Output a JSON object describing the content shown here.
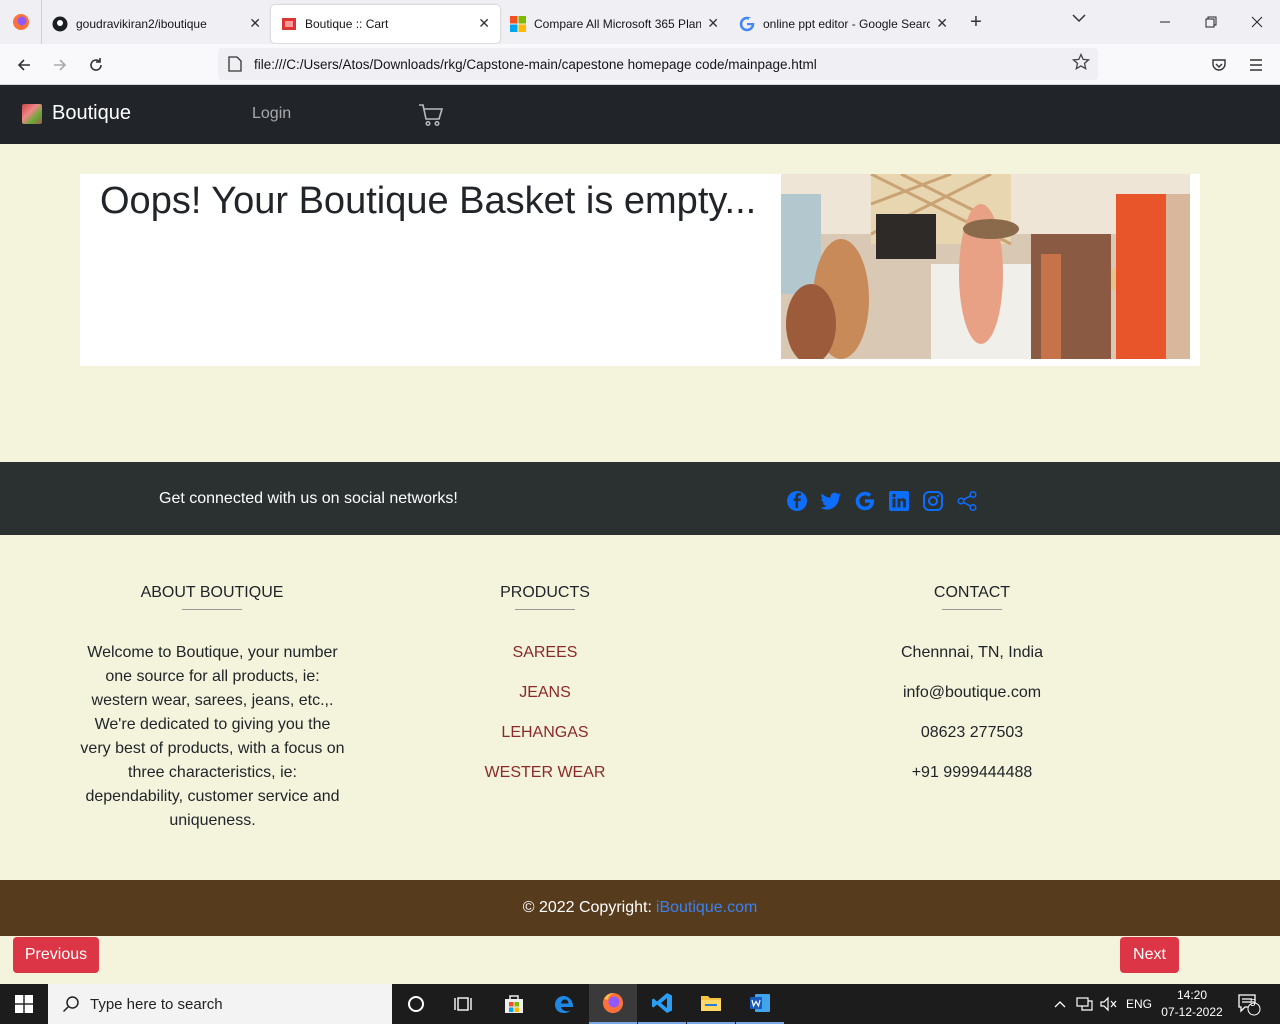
{
  "browser": {
    "tabs": [
      {
        "title": "goudravikiran2/iboutique",
        "icon": "github-icon",
        "active": false
      },
      {
        "title": "Boutique :: Cart",
        "icon": "boutique-favicon",
        "active": true
      },
      {
        "title": "Compare All Microsoft 365 Plan",
        "icon": "microsoft-icon",
        "active": false
      },
      {
        "title": "online ppt editor - Google Searc",
        "icon": "google-icon",
        "active": false
      }
    ],
    "close_glyph": "✕",
    "new_tab_glyph": "+",
    "url": "file:///C:/Users/Atos/Downloads/rkg/Capstone-main/capestone homepage code/mainpage.html"
  },
  "site": {
    "brand": "Boutique",
    "login": "Login",
    "empty_message": "Oops! Your Boutique Basket is empty...",
    "social_text": "Get connected with us on social networks!",
    "social_icons": [
      "facebook-icon",
      "twitter-icon",
      "google-icon",
      "linkedin-icon",
      "instagram-icon",
      "share-icon"
    ],
    "about": {
      "heading": "ABOUT BOUTIQUE",
      "text": "Welcome to Boutique, your number one source for all products, ie: western wear, sarees, jeans, etc.,. We're dedicated to giving you the very best of products, with a focus on three characteristics, ie: dependability, customer service and uniqueness."
    },
    "products": {
      "heading": "PRODUCTS",
      "items": [
        "SAREES",
        "JEANS",
        "LEHANGAS",
        "WESTER WEAR"
      ]
    },
    "contact": {
      "heading": "CONTACT",
      "items": [
        "Chennnai, TN, India",
        "info@boutique.com",
        "08623 277503",
        "+91 9999444488"
      ]
    },
    "copyright_prefix": "© 2022 Copyright:",
    "copyright_link": "iBoutique.com",
    "prev_button": "Previous",
    "next_button": "Next"
  },
  "taskbar": {
    "search_placeholder": "Type here to search",
    "language": "ENG",
    "time": "14:20",
    "date": "07-12-2022",
    "notification_count": "5"
  },
  "colors": {
    "page_bg": "#f4f3dc",
    "navbar_bg": "#212529",
    "social_bg": "#2b3031",
    "copyright_bg": "#573b1d",
    "button_red": "#dc3545",
    "link_blue": "#0d6efd",
    "product_link": "#8b2a2a"
  }
}
